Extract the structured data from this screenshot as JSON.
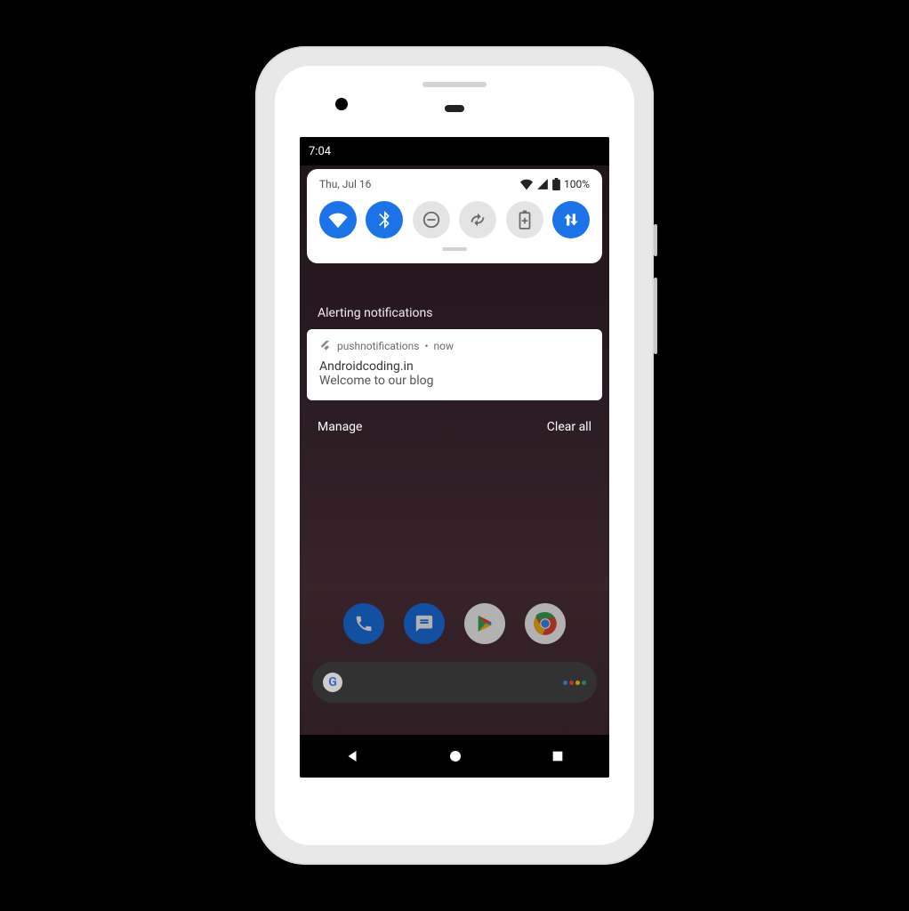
{
  "status_bar": {
    "time": "7:04"
  },
  "qs": {
    "date": "Thu, Jul 16",
    "battery_pct": "100%",
    "toggles": [
      {
        "name": "wifi",
        "on": true
      },
      {
        "name": "bluetooth",
        "on": true
      },
      {
        "name": "dnd",
        "on": false
      },
      {
        "name": "rotate",
        "on": false
      },
      {
        "name": "battery-saver",
        "on": false
      },
      {
        "name": "data",
        "on": true
      }
    ]
  },
  "section_label": "Alerting notifications",
  "notification": {
    "app": "pushnotifications",
    "when": "now",
    "title": "Androidcoding.in",
    "body": "Welcome to our blog"
  },
  "actions": {
    "manage": "Manage",
    "clear": "Clear all"
  }
}
